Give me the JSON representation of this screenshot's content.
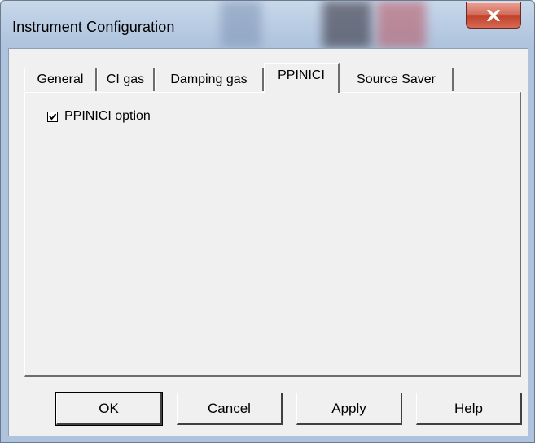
{
  "window": {
    "title": "Instrument Configuration",
    "close_label": "X"
  },
  "tabs": [
    {
      "label": "General",
      "active": false
    },
    {
      "label": "CI gas",
      "active": false
    },
    {
      "label": "Damping gas",
      "active": false
    },
    {
      "label": "PPINICI",
      "active": true
    },
    {
      "label": "Source Saver",
      "active": false
    }
  ],
  "panel": {
    "checkbox_label": "PPINICI option",
    "checkbox_checked": true
  },
  "buttons": {
    "ok": "OK",
    "cancel": "Cancel",
    "apply": "Apply",
    "help": "Help"
  },
  "colors": {
    "titlebar": "#b9cce3",
    "face": "#f0f0f0",
    "close_red": "#c2432d"
  },
  "icons": {
    "close": "close-icon",
    "check": "checkmark-icon"
  }
}
